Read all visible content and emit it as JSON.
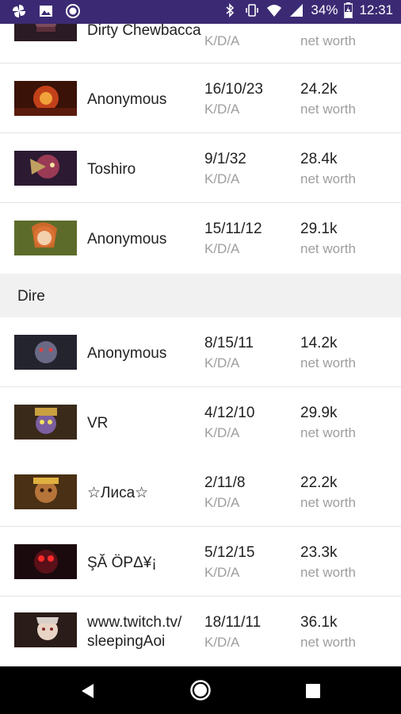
{
  "status_bar": {
    "battery": "34%",
    "time": "12:31"
  },
  "labels": {
    "kda": "K/D/A",
    "net_worth": "net worth"
  },
  "partial_row": {
    "name": "Dirty Chewbacca"
  },
  "radiant_rows": [
    {
      "name": "Anonymous",
      "kda": "16/10/23",
      "net_worth": "24.2k"
    },
    {
      "name": "Toshiro",
      "kda": "9/1/32",
      "net_worth": "28.4k"
    },
    {
      "name": "Anonymous",
      "kda": "15/11/12",
      "net_worth": "29.1k"
    }
  ],
  "section": {
    "title": "Dire"
  },
  "dire_rows": [
    {
      "name": "Anonymous",
      "kda": "8/15/11",
      "net_worth": "14.2k"
    },
    {
      "name": "VR",
      "kda": "4/12/10",
      "net_worth": "29.9k"
    },
    {
      "name": "☆Лиса☆",
      "kda": "2/11/8",
      "net_worth": "22.2k"
    },
    {
      "name": "ŞĂ ÖРΔ¥¡",
      "kda": "5/12/15",
      "net_worth": "23.3k"
    },
    {
      "name_line1": "www.twitch.tv/",
      "name_line2": "sleepingAoi",
      "kda": "18/11/11",
      "net_worth": "36.1k"
    }
  ],
  "colors": {
    "status_bar": "#3b2a73",
    "section_bg": "#f1f1f1"
  }
}
